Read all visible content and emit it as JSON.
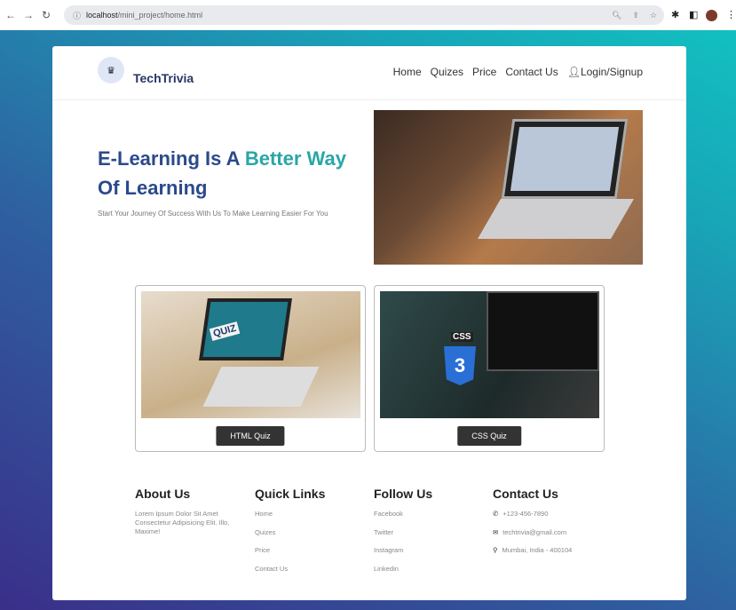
{
  "browser": {
    "url_host": "localhost",
    "url_path": "/mini_project/home.html"
  },
  "nav": {
    "brand": "TechTrivia",
    "links": [
      "Home",
      "Quizes",
      "Price",
      "Contact Us"
    ],
    "login": "Login/Signup"
  },
  "hero": {
    "title_part1": "E-Learning Is A ",
    "title_accent": "Better Way",
    "title_part2": "Of Learning",
    "subtitle": "Start Your Journey Of Success With Us To Make Learning Easier For You"
  },
  "quizzes": [
    {
      "label": "HTML Quiz",
      "image_text": "QUIZ"
    },
    {
      "label": "CSS Quiz",
      "image_text": "CSS"
    }
  ],
  "footer": {
    "about": {
      "title": "About Us",
      "text": "Lorem Ipsum Dolor Sit Amet Consectetur Adipisicing Elit. Illo, Maxime!"
    },
    "quick": {
      "title": "Quick Links",
      "items": [
        "Home",
        "Quizes",
        "Price",
        "Contact Us"
      ]
    },
    "follow": {
      "title": "Follow Us",
      "items": [
        "Facebook",
        "Twitter",
        "Instagram",
        "Linkedin"
      ]
    },
    "contact": {
      "title": "Contact Us",
      "phone": "+123-456-7890",
      "email": "techtrivia@gmail.com",
      "address": "Mumbai, India - 400104"
    }
  }
}
